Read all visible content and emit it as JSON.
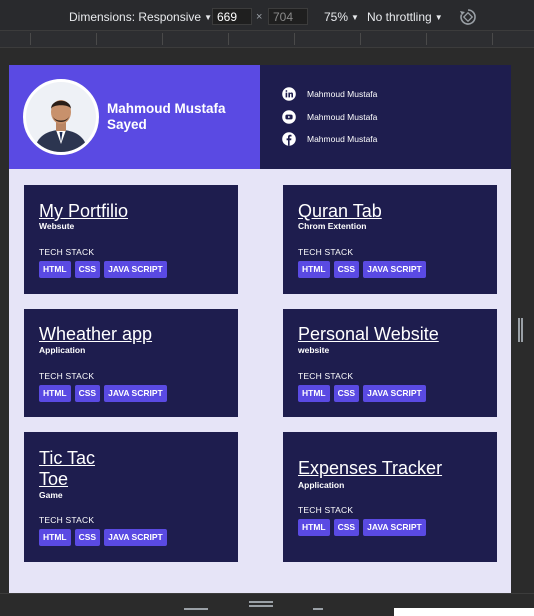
{
  "devtools": {
    "dimensions_label": "Dimensions: Responsive",
    "width": "669",
    "height": "704",
    "times": "×",
    "zoom": "75%",
    "throttling": "No throttling"
  },
  "profile": {
    "name": "Mahmoud Mustafa Sayed"
  },
  "social": [
    {
      "icon": "linkedin-icon",
      "label": "Mahmoud Mustafa"
    },
    {
      "icon": "youtube-icon",
      "label": "Mahmoud Mustafa"
    },
    {
      "icon": "facebook-icon",
      "label": "Mahmoud Mustafa"
    }
  ],
  "projects": [
    {
      "title": "My Portfilio",
      "subtitle": "Websute",
      "stack_label": "TECH STACK",
      "tags": [
        "HTML",
        "CSS",
        "JAVA SCRIPT"
      ]
    },
    {
      "title": "Quran Tab",
      "subtitle": "Chrom Extention",
      "stack_label": "TECH STACK",
      "tags": [
        "HTML",
        "CSS",
        "JAVA SCRIPT"
      ]
    },
    {
      "title": "Wheather app",
      "subtitle": "Application",
      "stack_label": "TECH STACK",
      "tags": [
        "HTML",
        "CSS",
        "JAVA SCRIPT"
      ]
    },
    {
      "title": "Personal Website",
      "subtitle": "website",
      "stack_label": "TECH STACK",
      "tags": [
        "HTML",
        "CSS",
        "JAVA SCRIPT"
      ]
    },
    {
      "title": "Tic Tac Toe",
      "subtitle": "Game",
      "stack_label": "TECH STACK",
      "tags": [
        "HTML",
        "CSS",
        "JAVA SCRIPT"
      ]
    },
    {
      "title": "Expenses Tracker",
      "subtitle": "Application",
      "stack_label": "TECH STACK",
      "tags": [
        "HTML",
        "CSS",
        "JAVA SCRIPT"
      ]
    }
  ],
  "colors": {
    "primary": "#5a4ae3",
    "navy": "#1e1d4e",
    "background": "#e6e4f7"
  }
}
